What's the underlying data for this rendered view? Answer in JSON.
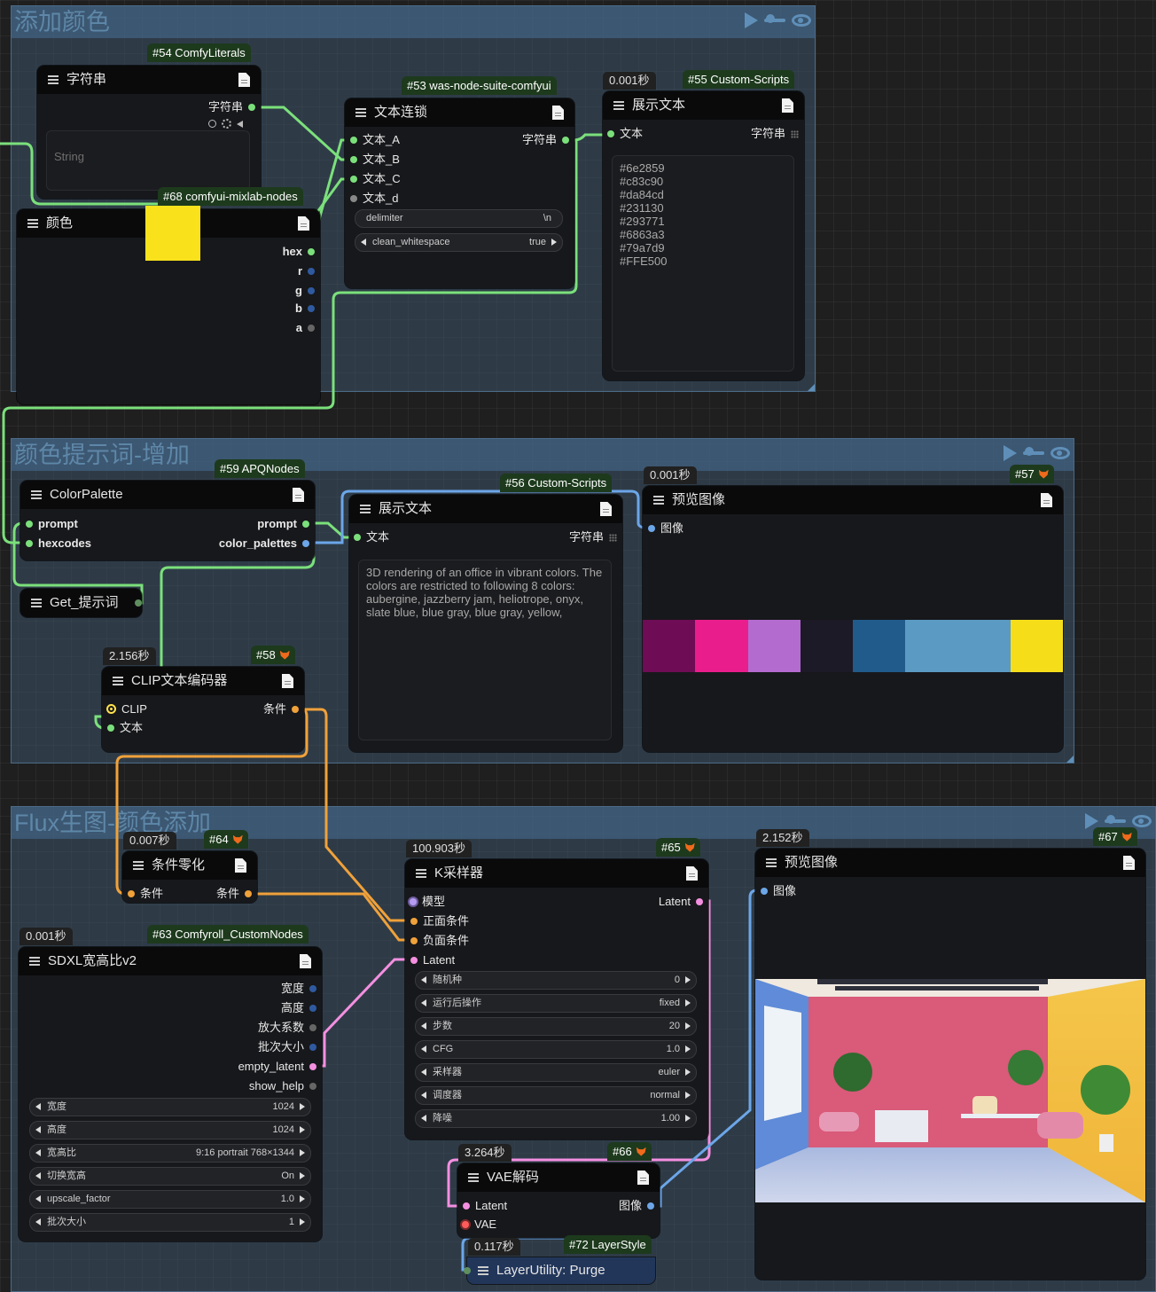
{
  "groups": {
    "add_color": {
      "title": "添加颜色"
    },
    "color_prompt": {
      "title": "颜色提示词-增加"
    },
    "flux": {
      "title": "Flux生图-颜色添加"
    }
  },
  "nodes": {
    "n54": {
      "badge": "#54 ComfyLiterals",
      "title": "字符串",
      "out_label": "字符串",
      "placeholder": "String"
    },
    "n68": {
      "badge": "#68 comfyui-mixlab-nodes",
      "title": "颜色",
      "color_value": "#f9e21c",
      "outputs": [
        "hex",
        "r",
        "g",
        "b",
        "a"
      ]
    },
    "n53": {
      "badge": "#53 was-node-suite-comfyui",
      "title": "文本连锁",
      "inputs": [
        "文本_A",
        "文本_B",
        "文本_C",
        "文本_d"
      ],
      "out_label": "字符串",
      "delimiter_label": "delimiter",
      "delimiter_value": "\\n",
      "clean_label": "clean_whitespace",
      "clean_value": "true"
    },
    "n55": {
      "timer": "0.001秒",
      "badge": "#55 Custom-Scripts",
      "title": "展示文本",
      "in_label": "文本",
      "out_label": "字符串",
      "text": "#6e2859\n#c83c90\n#da84cd\n#231130\n#293771\n#6863a3\n#79a7d9\n#FFE500"
    },
    "n59": {
      "badge": "#59 APQNodes",
      "title": "ColorPalette",
      "inputs": [
        "prompt",
        "hexcodes"
      ],
      "outputs": [
        "prompt",
        "color_palettes"
      ]
    },
    "get": {
      "title": "Get_提示词"
    },
    "n56": {
      "badge": "#56 Custom-Scripts",
      "title": "展示文本",
      "in_label": "文本",
      "out_label": "字符串",
      "text": "3D rendering of an office in vibrant colors. The colors are restricted to following 8 colors: aubergine, jazzberry jam, heliotrope, onyx, slate blue, blue gray, blue gray, yellow,"
    },
    "n57": {
      "timer": "0.001秒",
      "badge": "#57",
      "title": "预览图像",
      "in_label": "图像",
      "palette": [
        "#6e0c55",
        "#e91e8c",
        "#b36bcf",
        "#1b1a26",
        "#215b8b",
        "#5b9ac3",
        "#5b9ac3",
        "#f5de19"
      ]
    },
    "n58": {
      "timer": "2.156秒",
      "badge": "#58",
      "title": "CLIP文本编码器",
      "inputs": [
        "CLIP",
        "文本"
      ],
      "out_label": "条件"
    },
    "n64": {
      "timer": "0.007秒",
      "badge": "#64",
      "title": "条件零化",
      "in_label": "条件",
      "out_label": "条件"
    },
    "n63": {
      "timer": "0.001秒",
      "badge": "#63 Comfyroll_CustomNodes",
      "title": "SDXL宽高比v2",
      "outputs": [
        "宽度",
        "高度",
        "放大系数",
        "批次大小",
        "empty_latent",
        "show_help"
      ],
      "widgets": [
        {
          "label": "宽度",
          "value": "1024"
        },
        {
          "label": "高度",
          "value": "1024"
        },
        {
          "label": "宽高比",
          "value": "9:16 portrait 768×1344"
        },
        {
          "label": "切换宽高",
          "value": "On"
        },
        {
          "label": "upscale_factor",
          "value": "1.0"
        },
        {
          "label": "批次大小",
          "value": "1"
        }
      ]
    },
    "n65": {
      "timer": "100.903秒",
      "badge": "#65",
      "title": "K采样器",
      "inputs": [
        "模型",
        "正面条件",
        "负面条件",
        "Latent"
      ],
      "out_label": "Latent",
      "widgets": [
        {
          "label": "随机种",
          "value": "0"
        },
        {
          "label": "运行后操作",
          "value": "fixed"
        },
        {
          "label": "步数",
          "value": "20"
        },
        {
          "label": "CFG",
          "value": "1.0"
        },
        {
          "label": "采样器",
          "value": "euler"
        },
        {
          "label": "调度器",
          "value": "normal"
        },
        {
          "label": "降噪",
          "value": "1.00"
        }
      ]
    },
    "n66": {
      "timer": "3.264秒",
      "badge": "#66",
      "title": "VAE解码",
      "inputs": [
        "Latent",
        "VAE"
      ],
      "out_label": "图像"
    },
    "n72": {
      "timer": "0.117秒",
      "badge": "#72 LayerStyle",
      "title": "LayerUtility: Purge"
    },
    "n67": {
      "timer": "2.152秒",
      "badge": "#67",
      "title": "预览图像",
      "in_label": "图像"
    }
  },
  "colors": {
    "string_wire": "#7be07b",
    "image_wire": "#6ca6e8",
    "cond_wire": "#f0a13a",
    "latent_wire": "#f48fe0",
    "clip_dot": "#ffe34d",
    "vae_dot": "#ff5c5c",
    "model_dot": "#b59cf0"
  }
}
